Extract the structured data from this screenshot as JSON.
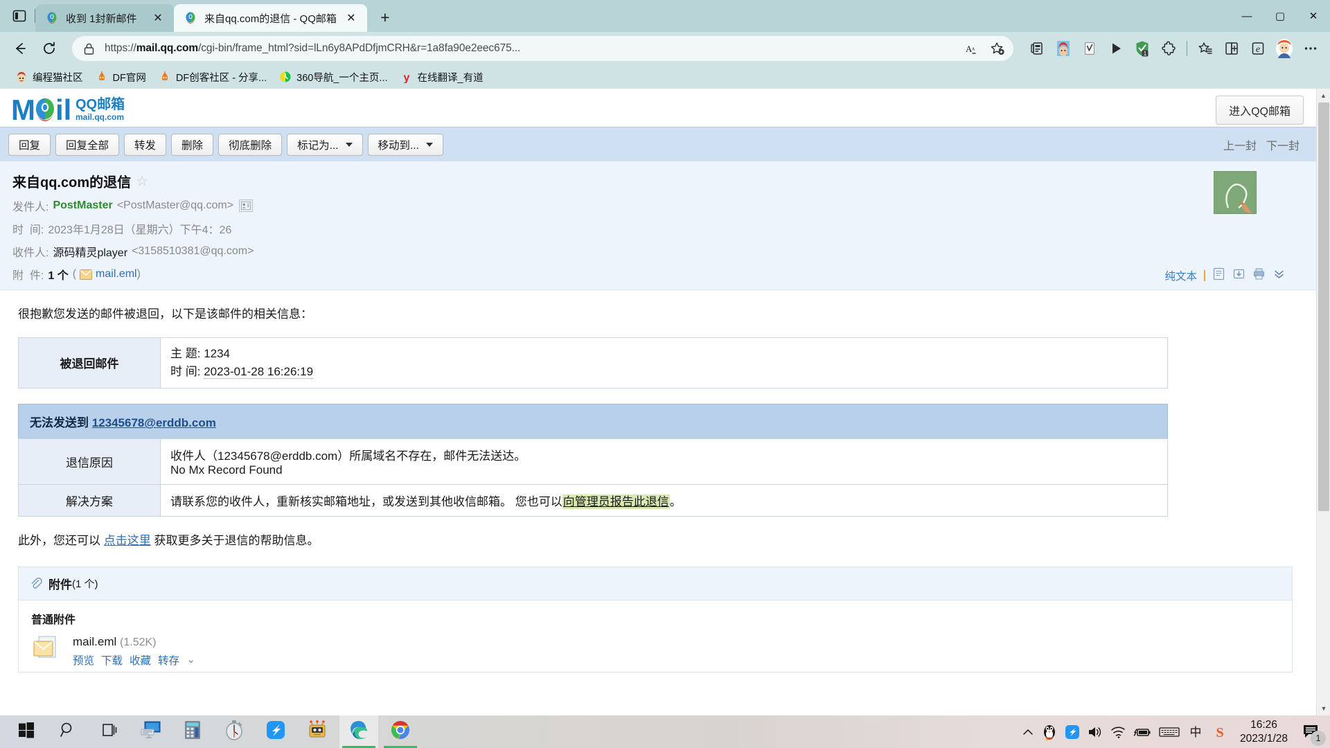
{
  "browser": {
    "tabs": [
      {
        "title": "收到 1封新邮件",
        "favicon": "qqmail-icon",
        "active": false
      },
      {
        "title": "来自qq.com的退信 - QQ邮箱",
        "favicon": "qqmail-icon",
        "active": true
      }
    ],
    "new_tab_label": "+",
    "tab_close_label": "✕",
    "tab_search_icon": "tab-list-icon",
    "window_controls": {
      "minimize": "—",
      "maximize": "▢",
      "close": "✕"
    },
    "nav": {
      "back": "←",
      "forward": "↻",
      "refresh": "↻"
    },
    "omnibox": {
      "lock_icon": "lock-icon",
      "url_prefix": "https://",
      "url_domain": "mail.qq.com",
      "url_rest": "/cgi-bin/frame_html?sid=lLn6y8APdDfjmCRH&r=1a8fa90e2eec675...",
      "read_aloud_icon": "read-aloud-icon",
      "favorite_icon": "star-add-icon"
    },
    "toolbar_icons": [
      "collections-icon",
      "extension-avatar-icon",
      "checkmark-box-icon",
      "play-icon",
      "adblock-shield-icon",
      "extensions-puzzle-icon",
      "favorites-star-icon",
      "split-screen-icon",
      "ie-mode-icon",
      "profile-avatar-icon",
      "settings-more-icon"
    ],
    "adblock_badge": "1",
    "bookmarks": [
      {
        "label": "编程猫社区",
        "icon": "codemao-icon"
      },
      {
        "label": "DF官网",
        "icon": "df-icon"
      },
      {
        "label": "DF创客社区 - 分享...",
        "icon": "df-icon"
      },
      {
        "label": "360导航_一个主页...",
        "icon": "360-icon"
      },
      {
        "label": "在线翻译_有道",
        "icon": "youdao-icon"
      }
    ]
  },
  "qqmail": {
    "logo": {
      "mail_text": "Mail",
      "brand": "QQ邮箱",
      "domain": "mail.qq.com"
    },
    "enter_button": "进入QQ邮箱",
    "toolbar_buttons": [
      {
        "label": "回复",
        "has_caret": false
      },
      {
        "label": "回复全部",
        "has_caret": false
      },
      {
        "label": "转发",
        "has_caret": false
      },
      {
        "label": "删除",
        "has_caret": false
      },
      {
        "label": "彻底删除",
        "has_caret": false
      },
      {
        "label": "标记为...",
        "has_caret": true
      },
      {
        "label": "移动到...",
        "has_caret": true
      }
    ],
    "nav_prev": "上一封",
    "nav_next": "下一封",
    "mail": {
      "subject": "来自qq.com的退信",
      "star_icon": "star-outline-icon",
      "from_label": "发件人:",
      "from_name": "PostMaster",
      "from_address": "<PostMaster@qq.com>",
      "contact_card_icon": "contact-card-icon",
      "date_label": "时  间:",
      "date_value": "2023年1月28日（星期六）下午4：26",
      "to_label": "收件人:",
      "to_name": "源码精灵player",
      "to_address": "<3158510381@qq.com>",
      "attach_label": "附  件:",
      "attach_count": "1 个",
      "attach_paren_open": "(",
      "attach_file": "mail.eml",
      "attach_paren_close": ")",
      "attach_icon": "eml-envelope-icon",
      "actions": {
        "plain_text": "纯文本",
        "icons": [
          "note-icon",
          "save-to-file-icon",
          "print-icon",
          "more-chevron-icon"
        ]
      },
      "avatar_icon": "chalkboard-portrait-avatar"
    },
    "body": {
      "intro": "很抱歉您发送的邮件被退回，以下是该邮件的相关信息：",
      "returned_mail_table": {
        "key": "被退回邮件",
        "rows": [
          {
            "label": "主 题:",
            "value": "1234"
          },
          {
            "label": "时 间:",
            "value": "2023-01-28 16:26:19"
          }
        ]
      },
      "bounce_title_prefix": "无法发送到 ",
      "bounce_title_address": "12345678@erddb.com",
      "bounce_rows": [
        {
          "key": "退信原因",
          "line1": "收件人（12345678@erddb.com）所属域名不存在，邮件无法送达。",
          "line2": "No Mx Record Found"
        }
      ],
      "solution_key": "解决方案",
      "solution_text_a": "请联系您的收件人，重新核实邮箱地址，或发送到其他收信邮箱。 您也可以",
      "solution_link": "向管理员报告此退信",
      "solution_text_b": "。",
      "footer_text_a": "此外，您还可以 ",
      "footer_link": "点击这里",
      "footer_text_b": " 获取更多关于退信的帮助信息。"
    },
    "attachments": {
      "header_title": "附件",
      "header_count": "(1 个)",
      "paperclip_icon": "paperclip-icon",
      "group_title": "普通附件",
      "items": [
        {
          "name": "mail.eml",
          "size": "(1.52K)",
          "icon": "eml-envelope-icon",
          "actions": [
            "预览",
            "下载",
            "收藏",
            "转存"
          ]
        }
      ]
    }
  },
  "taskbar": {
    "items": [
      {
        "name": "start-button",
        "icon": "windows-logo-icon"
      },
      {
        "name": "search-button",
        "icon": "magnifier-icon"
      },
      {
        "name": "task-view-button",
        "icon": "task-view-icon"
      },
      {
        "name": "remote-desktop",
        "icon": "monitor-keyboard-icon"
      },
      {
        "name": "calculator",
        "icon": "calculator-icon"
      },
      {
        "name": "clock-app",
        "icon": "stopwatch-icon"
      },
      {
        "name": "app-blue-bird",
        "icon": "blue-swift-icon"
      },
      {
        "name": "mblock-robot",
        "icon": "robot-icon"
      },
      {
        "name": "microsoft-edge",
        "icon": "edge-icon",
        "running": true,
        "active": true
      },
      {
        "name": "google-chrome",
        "icon": "chrome-icon",
        "running": true
      }
    ],
    "tray": {
      "overflow_icon": "chevron-up-icon",
      "icons": [
        "qq-penguin-icon",
        "wps-icon",
        "volume-icon",
        "wifi-icon",
        "battery-icon",
        "keyboard-icon",
        "ime-chinese-icon",
        "sogou-icon"
      ],
      "ime_label": "中",
      "time": "16:26",
      "date": "2023/1/28",
      "notification_icon": "notification-icon",
      "notification_count": "1"
    }
  },
  "colors": {
    "browser_chrome": "#cfe3e4",
    "tab_active": "#f3f8f9",
    "mail_toolbar": "#cfe0f3",
    "bounce_header": "#b9d0ea",
    "highlight_link": "#d9e8b4",
    "accent_link": "#2f6fb5"
  }
}
